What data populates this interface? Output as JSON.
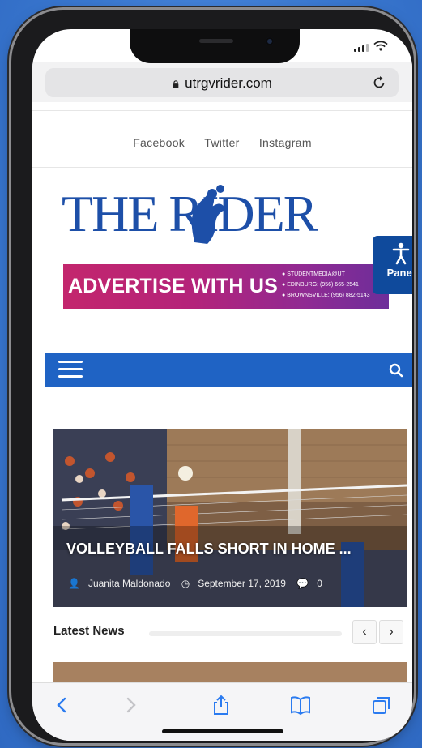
{
  "browser": {
    "url": "utrgvrider.com"
  },
  "social_links": [
    "Facebook",
    "Twitter",
    "Instagram"
  ],
  "site": {
    "logo_text": "THE RIDER"
  },
  "accessibility_panel": {
    "label": "Panel"
  },
  "advert": {
    "title": "ADVERTISE WITH US",
    "contact_lines": [
      "STUDENTMEDIA@UT",
      "EDINBURG: (956) 665-2541",
      "BROWNSVILLE: (956) 882-5143"
    ]
  },
  "featured": {
    "headline": "VOLLEYBALL FALLS SHORT IN HOME ...",
    "author": "Juanita Maldonado",
    "date": "September 17, 2019",
    "comments": "0"
  },
  "latest_news": {
    "label": "Latest News",
    "prev": "‹",
    "next": "›"
  },
  "colors": {
    "nav_blue": "#1f63c4",
    "panel_blue": "#0f4a9c",
    "logo_blue": "#1d4fa8",
    "ad_magenta": "#c3266d",
    "background": "#3f7fd6"
  }
}
